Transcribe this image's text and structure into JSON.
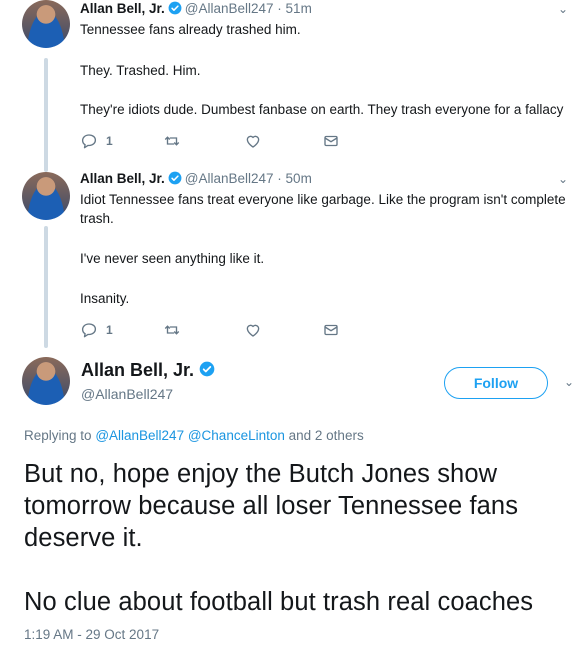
{
  "tweets": [
    {
      "name": "Allan Bell, Jr.",
      "handle_time": "@AllanBell247 · 51m",
      "lines": [
        "Tennessee fans already trashed him.",
        "They. Trashed. Him.",
        "They're idiots dude. Dumbest fanbase on earth. They trash everyone for a fallacy"
      ],
      "reply_count": "1"
    },
    {
      "name": "Allan Bell, Jr.",
      "handle_time": "@AllanBell247 · 50m",
      "lines": [
        "Idiot Tennessee fans treat everyone like garbage. Like the program isn't complete",
        "trash.",
        "I've never seen anything like it.",
        "Insanity."
      ],
      "reply_count": "1"
    }
  ],
  "main": {
    "name": "Allan Bell, Jr.",
    "handle": "@AllanBell247",
    "follow_label": "Follow",
    "replying_prefix": "Replying to",
    "replying_user1": "@AllanBell247",
    "replying_user2": "@ChanceLinton",
    "replying_suffix": "and 2 others",
    "text_lines": [
      "But no, hope enjoy the Butch Jones show",
      "tomorrow because all loser Tennessee fans",
      "deserve it.",
      "No clue about football but trash real coaches"
    ],
    "timestamp": "1:19 AM - 29 Oct 2017"
  },
  "colors": {
    "accent": "#1da1f2",
    "link": "#1b95e0",
    "muted": "#657786",
    "thread_line": "#cdd9e3"
  }
}
